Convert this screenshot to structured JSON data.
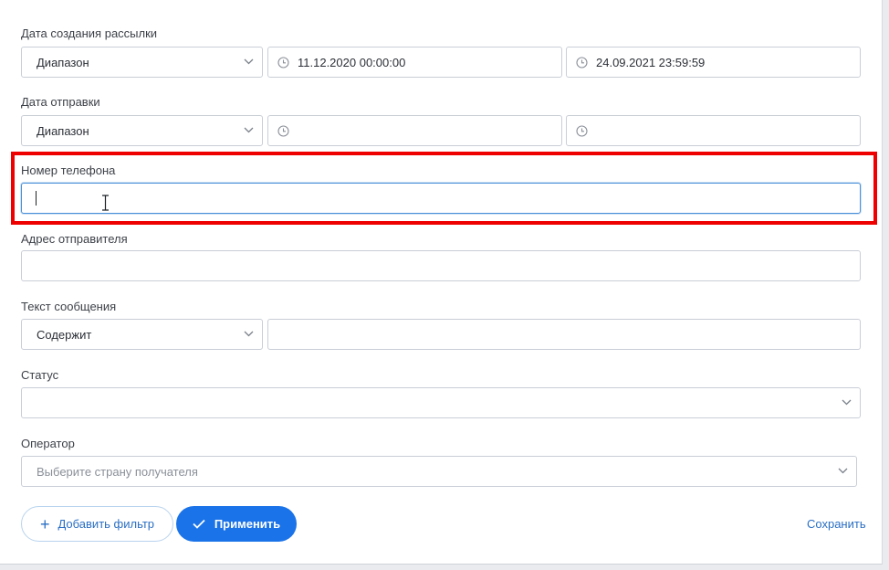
{
  "creation_date": {
    "label": "Дата создания рассылки",
    "mode": "Диапазон",
    "from": "11.12.2020 00:00:00",
    "to": "24.09.2021 23:59:59"
  },
  "send_date": {
    "label": "Дата отправки",
    "mode": "Диапазон",
    "from": "",
    "to": ""
  },
  "phone": {
    "label": "Номер телефона",
    "value": ""
  },
  "sender": {
    "label": "Адрес отправителя",
    "value": ""
  },
  "message": {
    "label": "Текст сообщения",
    "mode": "Содержит",
    "value": ""
  },
  "status": {
    "label": "Статус",
    "value": ""
  },
  "operator": {
    "label": "Оператор",
    "placeholder": "Выберите страну получателя"
  },
  "actions": {
    "add_filter": "Добавить фильтр",
    "apply": "Применить",
    "save": "Сохранить"
  },
  "colors": {
    "accent": "#1a73e8",
    "link": "#2a6fc4",
    "highlight": "#ee0000"
  }
}
